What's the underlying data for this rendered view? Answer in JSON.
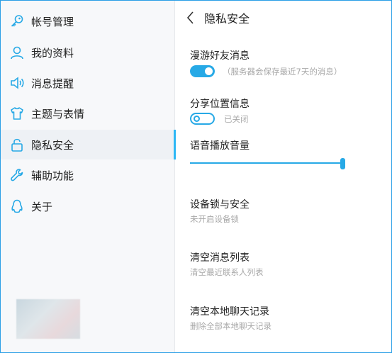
{
  "sidebar": {
    "items": [
      {
        "label": "帐号管理",
        "icon": "key-icon"
      },
      {
        "label": "我的资料",
        "icon": "user-icon"
      },
      {
        "label": "消息提醒",
        "icon": "speaker-icon"
      },
      {
        "label": "主题与表情",
        "icon": "shirt-icon"
      },
      {
        "label": "隐私安全",
        "icon": "lock-icon",
        "active": true
      },
      {
        "label": "辅助功能",
        "icon": "wrench-icon"
      },
      {
        "label": "关于",
        "icon": "penguin-icon"
      }
    ]
  },
  "header": {
    "back_icon": "chevron-left-icon",
    "title": "隐私安全"
  },
  "settings": {
    "roaming": {
      "title": "漫游好友消息",
      "enabled": true,
      "note": "（服务器会保存最近7天的消息）"
    },
    "location": {
      "title": "分享位置信息",
      "enabled": false,
      "note": "已关闭"
    },
    "volume": {
      "title": "语音播放音量",
      "level": 1.0
    },
    "device_lock": {
      "title": "设备锁与安全",
      "subtitle": "未开启设备锁"
    },
    "clear_messages": {
      "title": "清空消息列表",
      "subtitle": "清空最近联系人列表"
    },
    "clear_history": {
      "title": "清空本地聊天记录",
      "subtitle": "删除全部本地聊天记录"
    }
  },
  "colors": {
    "accent": "#27a9e6",
    "sidebar_bg": "#f7f8fa",
    "active_bg": "#eef1f5",
    "muted_text": "#a8a8a8"
  }
}
